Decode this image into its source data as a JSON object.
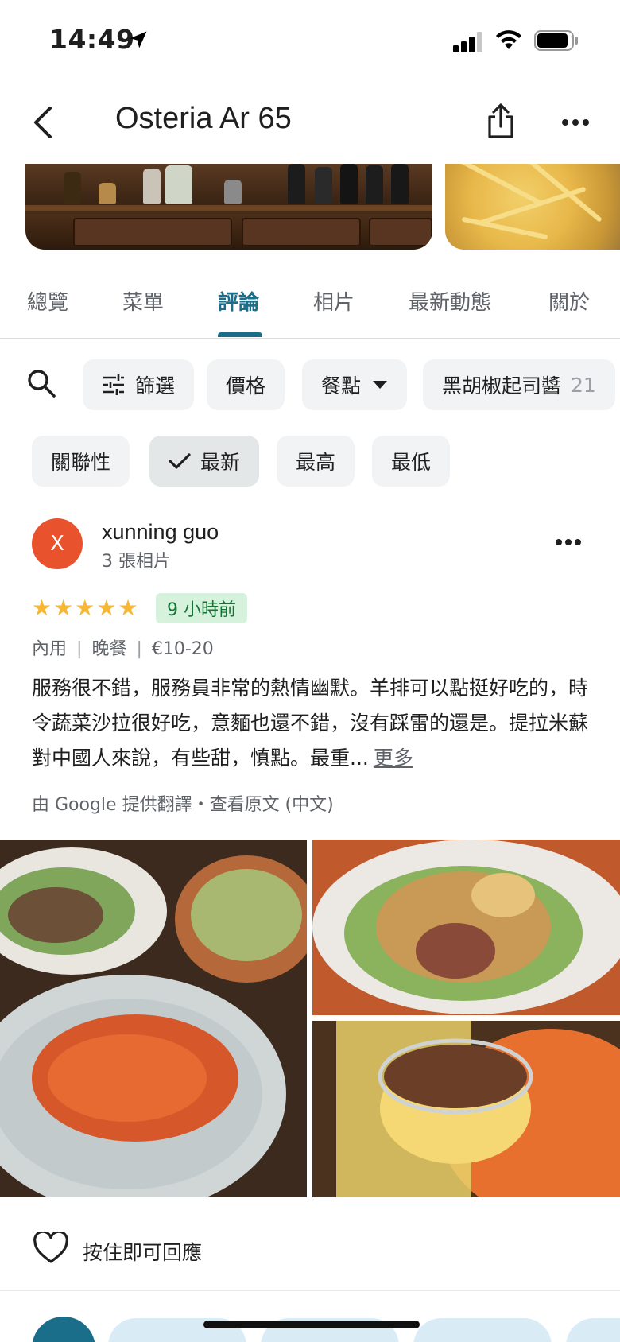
{
  "status_bar": {
    "time": "14:49"
  },
  "header": {
    "title": "Osteria Ar 65"
  },
  "tabs": [
    {
      "label": "總覽"
    },
    {
      "label": "菜單"
    },
    {
      "label": "評論"
    },
    {
      "label": "相片"
    },
    {
      "label": "最新動態"
    },
    {
      "label": "關於"
    }
  ],
  "active_tab": "評論",
  "filters": {
    "filter_label": "篩選",
    "price_label": "價格",
    "meal_label": "餐點",
    "topic_label": "黑胡椒起司醬",
    "topic_count": "21"
  },
  "sort": {
    "relevance": "關聯性",
    "newest": "最新",
    "highest": "最高",
    "lowest": "最低",
    "selected": "最新"
  },
  "review": {
    "avatar_letter": "X",
    "name": "xunning guo",
    "photos_count": "3 張相片",
    "rating": 5,
    "time_ago": "9 小時前",
    "service": "內用",
    "meal": "晚餐",
    "price": "€10-20",
    "text": "服務很不錯，服務員非常的熱情幽默。羊排可以點挺好吃的，時令蔬菜沙拉很好吃，意麵也還不錯，沒有踩雷的還是。提拉米蘇對中國人來說，有些甜，慎點。最重...",
    "more": "更多",
    "translation_note": "由 Google 提供翻譯・查看原文 (中文)"
  },
  "reply": {
    "label": "按住即可回應"
  },
  "colors": {
    "accent": "#1a6e8a",
    "star": "#f6b732",
    "badge_bg": "#d6f2dd",
    "badge_text": "#137333",
    "avatar": "#e8532d"
  },
  "icons": [
    "back-arrow-icon",
    "share-icon",
    "more-vert-icon",
    "search-icon",
    "tune-icon",
    "dropdown-icon",
    "check-icon",
    "heart-icon",
    "location-arrow-icon",
    "signal-icon",
    "wifi-icon",
    "battery-icon"
  ]
}
